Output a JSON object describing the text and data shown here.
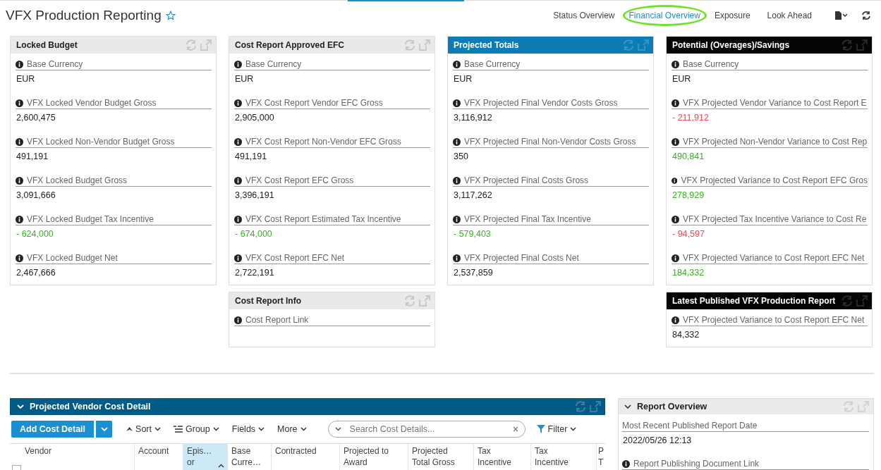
{
  "app": {
    "title": "VFX Production Reporting",
    "favorite": false
  },
  "nav": [
    {
      "label": "Status Overview",
      "selected": false
    },
    {
      "label": "Financial Overview",
      "selected": true
    },
    {
      "label": "Exposure",
      "selected": false
    },
    {
      "label": "Look Ahead",
      "selected": false
    }
  ],
  "columns": [
    {
      "cards": [
        {
          "title": "Locked Budget",
          "kind": "light",
          "fields": [
            {
              "label": "Base Currency",
              "value": "EUR",
              "color": "#222222"
            },
            {
              "label": "VFX Locked Vendor Budget Gross",
              "value": "2,600,475",
              "color": "#222222"
            },
            {
              "label": "VFX Locked Non-Vendor Budget Gross",
              "value": "491,191",
              "color": "#222222"
            },
            {
              "label": "VFX Locked Budget Gross",
              "value": "3,091,666",
              "color": "#222222"
            },
            {
              "label": "VFX Locked Budget Tax Incentive",
              "value": "- 624,000",
              "color": "#35b31f"
            },
            {
              "label": "VFX Locked Budget Net",
              "value": "2,467,666",
              "color": "#222222"
            }
          ]
        }
      ]
    },
    {
      "cards": [
        {
          "title": "Cost Report Approved EFC",
          "kind": "light",
          "fields": [
            {
              "label": "Base Currency",
              "value": "EUR",
              "color": "#222222"
            },
            {
              "label": "VFX Cost Report Vendor EFC Gross",
              "value": "2,905,000",
              "color": "#222222"
            },
            {
              "label": "VFX Cost Report Non-Vendor EFC Gross",
              "value": "491,191",
              "color": "#222222"
            },
            {
              "label": "VFX Cost Report EFC Gross",
              "value": "3,396,191",
              "color": "#222222"
            },
            {
              "label": "VFX Cost Report Estimated Tax Incentive",
              "value": "- 674,000",
              "color": "#35b31f"
            },
            {
              "label": "VFX Cost Report EFC Net",
              "value": "2,722,191",
              "color": "#222222"
            }
          ]
        },
        {
          "title": "Cost Report Info",
          "kind": "light",
          "fields": [
            {
              "label": "Cost Report Link"
            }
          ]
        }
      ]
    },
    {
      "cards": [
        {
          "title": "Projected Totals",
          "kind": "blue",
          "fields": [
            {
              "label": "Base Currency",
              "value": "EUR",
              "color": "#222222"
            },
            {
              "label": "VFX Projected Final Vendor Costs Gross",
              "value": "3,116,912",
              "color": "#222222"
            },
            {
              "label": "VFX Projected Final Non-Vendor Costs Gross",
              "value": "350",
              "color": "#222222"
            },
            {
              "label": "VFX Projected Final Costs Gross",
              "value": "3,117,262",
              "color": "#222222"
            },
            {
              "label": "VFX Projected Final Tax Incentive",
              "value": "- 579,403",
              "color": "#35b31f"
            },
            {
              "label": "VFX Projected Final Costs Net",
              "value": "2,537,859",
              "color": "#222222"
            }
          ]
        }
      ]
    },
    {
      "cards": [
        {
          "title": "Potential (Overages)/Savings",
          "kind": "black",
          "fields": [
            {
              "label": "Base Currency",
              "value": "EUR",
              "color": "#222222"
            },
            {
              "label": "VFX Projected Vendor Variance to Cost Report E",
              "value": "- 211,912",
              "color": "#f0474a"
            },
            {
              "label": "VFX Projected Non-Vendor Variance to Cost Rep",
              "value": "490,841",
              "color": "#35b31f"
            },
            {
              "label": "VFX Projected Variance to Cost Report EFC Gros",
              "value": "278,929",
              "color": "#35b31f"
            },
            {
              "label": "VFX Projected Tax Incentive Variance to Cost Re",
              "value": "- 94,597",
              "color": "#f0474a"
            },
            {
              "label": "VFX Projected Variance to Cost Report EFC Net",
              "value": "184,332",
              "color": "#35b31f"
            }
          ]
        },
        {
          "title": "Latest Published VFX Production Report",
          "kind": "black",
          "fields": [
            {
              "label": "VFX Projected Variance to Cost Report EFC Net",
              "value": "84,332",
              "color": "#222222"
            }
          ]
        }
      ]
    }
  ],
  "vendor_panel": {
    "title": "Projected Vendor Cost Detail",
    "expanded": true,
    "add_button": "Add Cost Detail",
    "tools": [
      {
        "label": "Sort",
        "kind": "sort"
      },
      {
        "label": "Group",
        "kind": "group"
      },
      {
        "label": "Fields",
        "kind": "plain"
      },
      {
        "label": "More",
        "kind": "plain"
      }
    ],
    "search": {
      "placeholder": "Search Cost Details..."
    },
    "filter": "Filter",
    "select_all_checked": false,
    "columns": [
      {
        "label": "Vendor",
        "sorted": false
      },
      {
        "label": "Account",
        "sorted": false
      },
      {
        "label": "Epis…\nor",
        "sorted": true
      },
      {
        "label": "Base\nCurre…",
        "sorted": false
      },
      {
        "label": "Contracted",
        "sorted": false
      },
      {
        "label": "Projected to\nAward",
        "sorted": false
      },
      {
        "label": "Projected\nTotal Gross",
        "sorted": false
      },
      {
        "label": "Tax\nIncentive",
        "sorted": false
      },
      {
        "label": "Tax\nIncentive",
        "sorted": false
      },
      {
        "label": "P\nT",
        "sorted": false
      }
    ]
  },
  "report_panel": {
    "title": "Report Overview",
    "expanded": true,
    "fields": [
      {
        "label": "Most Recent Published Report Date",
        "value": "2022/05/26 12:13",
        "info": false
      },
      {
        "label": "Report Publishing Document Link",
        "info": true
      }
    ]
  }
}
